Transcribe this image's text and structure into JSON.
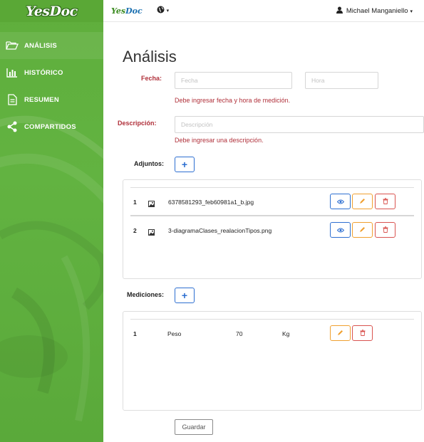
{
  "app": {
    "logo": "YesDoc",
    "brand_yes": "Yes",
    "brand_doc": "Doc",
    "user_name": "Michael Manganiello"
  },
  "sidebar": {
    "items": [
      {
        "label": "ANÁLISIS",
        "icon": "folder-open-icon"
      },
      {
        "label": "HISTÓRICO",
        "icon": "bar-chart-icon"
      },
      {
        "label": "RESUMEN",
        "icon": "document-icon"
      },
      {
        "label": "COMPARTIDOS",
        "icon": "share-icon"
      }
    ]
  },
  "main": {
    "title": "Análisis",
    "fecha": {
      "label": "Fecha:",
      "date_placeholder": "Fecha",
      "time_placeholder": "Hora",
      "error": "Debe ingresar fecha y hora de medición."
    },
    "descripcion": {
      "label": "Descripción:",
      "placeholder": "Descripción",
      "error": "Debe ingresar una descripción."
    },
    "adjuntos": {
      "label": "Adjuntos:",
      "add_label": "+",
      "rows": [
        {
          "num": "1",
          "file": "6378581293_feb60981a1_b.jpg"
        },
        {
          "num": "2",
          "file": "3-diagramaClases_realacionTipos.png"
        }
      ]
    },
    "mediciones": {
      "label": "Mediciones:",
      "add_label": "+",
      "rows": [
        {
          "num": "1",
          "name": "Peso",
          "value": "70",
          "unit": "Kg"
        }
      ]
    },
    "save_label": "Guardar"
  },
  "colors": {
    "sidebar_green": "#62b341",
    "error_red": "#b0303a",
    "primary_blue": "#2d6fd1",
    "warning_orange": "#f0a030",
    "danger_red": "#d9534f"
  }
}
